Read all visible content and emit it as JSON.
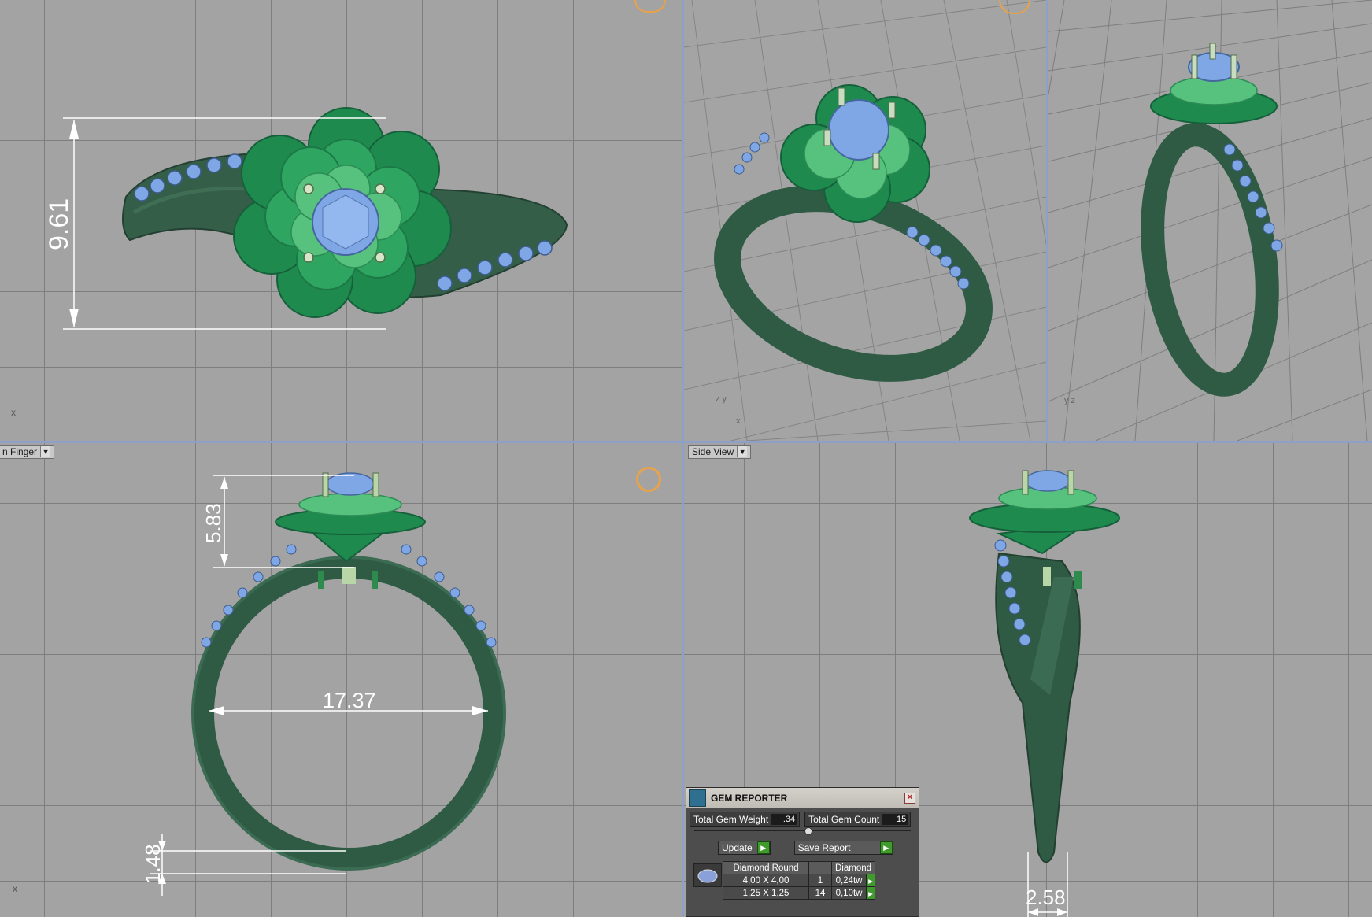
{
  "viewports": {
    "top_left": {
      "dimension": "9.61"
    },
    "bottom_left": {
      "label": "n Finger",
      "dimensions": {
        "height": "5.83",
        "diameter": "17.37",
        "thickness": "1.48"
      }
    },
    "bottom_right": {
      "label": "Side View",
      "dimensions": {
        "width": "2.58"
      }
    }
  },
  "gem_reporter": {
    "title": "GEM REPORTER",
    "total_weight_label": "Total Gem Weight",
    "total_weight_value": ".34",
    "total_count_label": "Total Gem Count",
    "total_count_value": "15",
    "update_label": "Update",
    "save_report_label": "Save Report",
    "table": {
      "headers": [
        "Diamond Round",
        "",
        "Diamond"
      ],
      "rows": [
        {
          "size": "4,00 X 4,00",
          "count": "1",
          "weight": "0,24tw"
        },
        {
          "size": "1,25 X 1,25",
          "count": "14",
          "weight": "0,10tw"
        }
      ]
    }
  },
  "colors": {
    "metal": "#2f5a44",
    "petal_dark": "#1f8a4e",
    "petal_light": "#4fc17a",
    "gem": "#7fa7e6",
    "prong": "#b8d6a8"
  }
}
